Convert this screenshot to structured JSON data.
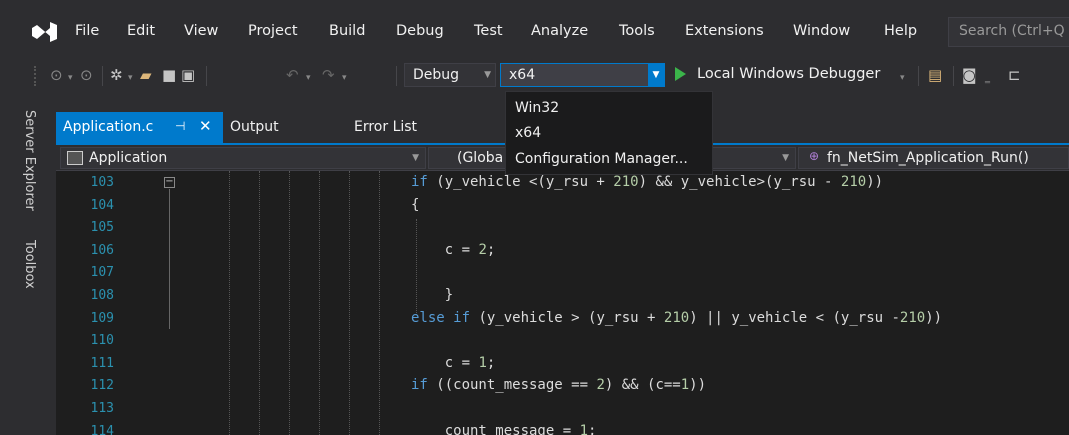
{
  "menu": {
    "items": [
      "File",
      "Edit",
      "View",
      "Project",
      "Build",
      "Debug",
      "Test",
      "Analyze",
      "Tools",
      "Extensions",
      "Window",
      "Help"
    ],
    "search_placeholder": "Search (Ctrl+Q"
  },
  "toolbar": {
    "configuration": "Debug",
    "platform": "x64",
    "debugger": "Local Windows Debugger"
  },
  "platform_dropdown": {
    "options": [
      "Win32",
      "x64",
      "Configuration Manager..."
    ]
  },
  "side_tabs": [
    "Server Explorer",
    "Toolbox"
  ],
  "tabs": {
    "active": "Application.c",
    "others": [
      "Output",
      "Error List"
    ]
  },
  "navbar": {
    "project": "Application",
    "scope": "(Globa",
    "member": "fn_NetSim_Application_Run()"
  },
  "editor": {
    "line_numbers": [
      "103",
      "104",
      "105",
      "106",
      "107",
      "108",
      "109",
      "110",
      "111",
      "112",
      "113",
      "114"
    ],
    "lines": [
      "if (y_vehicle <(y_rsu + 210) && y_vehicle>(y_rsu - 210))",
      "{",
      "",
      "    c = 2;",
      "",
      "    }",
      "else if (y_vehicle > (y_rsu + 210) || y_vehicle < (y_rsu -210))",
      "",
      "    c = 1;",
      "if ((count_message == 2) && (c==1))",
      "",
      "    count_message = 1;"
    ]
  },
  "colors": {
    "accent": "#007acc",
    "background": "#1e1e1e",
    "chrome": "#2d2d30"
  }
}
